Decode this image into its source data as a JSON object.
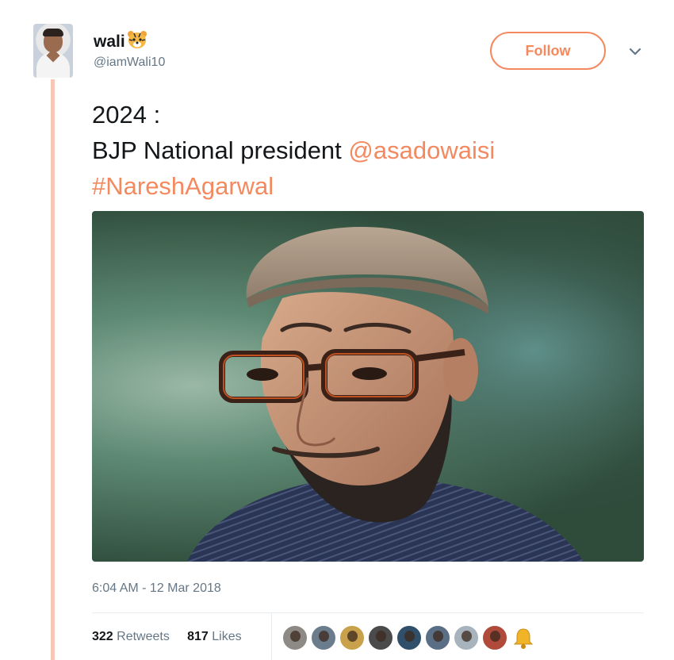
{
  "tweet": {
    "display_name": "wali",
    "handle": "@iamWali10",
    "follow_label": "Follow",
    "text_line1": "2024 :",
    "text_line2_prefix": "BJP National president ",
    "mention": "@asadowaisi",
    "hashtag": "#NareshAgarwal",
    "timestamp": "6:04 AM - 12 Mar 2018",
    "retweets_count": "322",
    "retweets_label": "Retweets",
    "likes_count": "817",
    "likes_label": "Likes"
  },
  "colors": {
    "accent": "#f4895f",
    "thread_line": "#f6c7b4",
    "muted": "#657786",
    "text": "#14171a"
  },
  "likers": [
    {
      "bg": "#8d8a86"
    },
    {
      "bg": "#6b7d8c"
    },
    {
      "bg": "#c9a14a"
    },
    {
      "bg": "#4b4b4b"
    },
    {
      "bg": "#2f4f6a"
    },
    {
      "bg": "#5a6f86"
    },
    {
      "bg": "#a7b3bd"
    },
    {
      "bg": "#b04a3b"
    },
    {
      "bg": "bell"
    }
  ]
}
